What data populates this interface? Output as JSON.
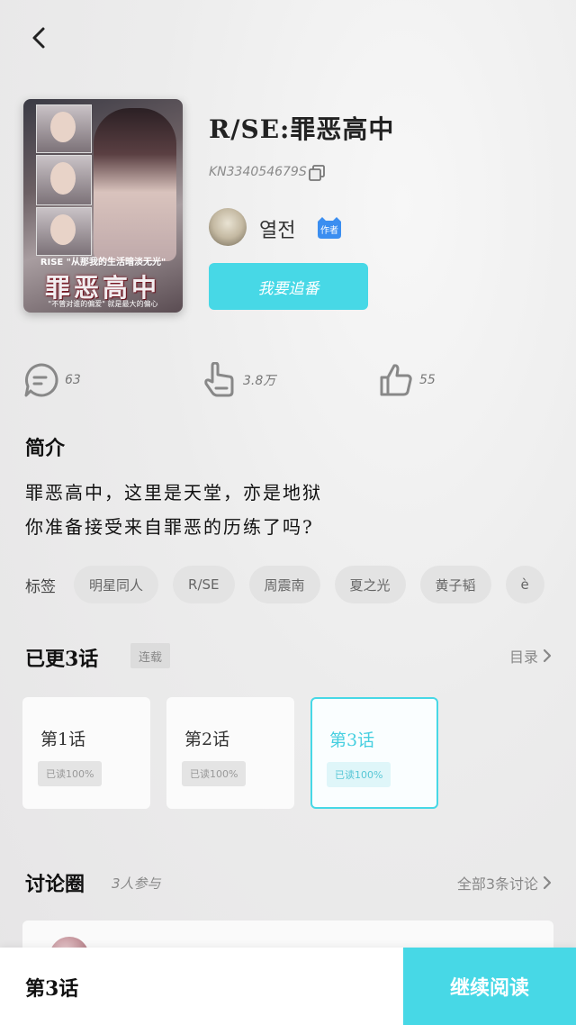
{
  "header": {
    "back_icon": "chevron-left-icon"
  },
  "book": {
    "cover": {
      "subtitle": "RISE \"从那我的生活暗淡无光\"",
      "title": "罪恶高中",
      "tagline": "\"不曾对谁的偏爱\" 就是最大的偏心"
    },
    "title": "R/SE:罪恶高中",
    "code": "KN334054679S",
    "author": {
      "name": "열전",
      "badge": "作者"
    },
    "follow_label": "我要追番"
  },
  "stats": {
    "comments": "63",
    "likes": "3.8万",
    "thumbs": "55"
  },
  "intro": {
    "heading": "简介",
    "lines": [
      "罪恶高中，这里是天堂，亦是地狱",
      "你准备接受来自罪恶的历练了吗?"
    ]
  },
  "tags": {
    "label": "标签",
    "items": [
      "明星同人",
      "R/SE",
      "周震南",
      "夏之光",
      "黄子韬",
      "è"
    ]
  },
  "episodes": {
    "heading": "已更3话",
    "status": "连载",
    "catalog_label": "目录",
    "items": [
      {
        "title": "第1话",
        "read": "已读100%"
      },
      {
        "title": "第2话",
        "read": "已读100%"
      },
      {
        "title": "第3话",
        "read": "已读100%"
      }
    ]
  },
  "discussion": {
    "heading": "讨论圈",
    "participants": "3人参与",
    "all_label": "全部3条讨论"
  },
  "bottom": {
    "current_episode": "第3话",
    "continue_label": "继续阅读"
  },
  "colors": {
    "accent": "#47d8e6"
  }
}
